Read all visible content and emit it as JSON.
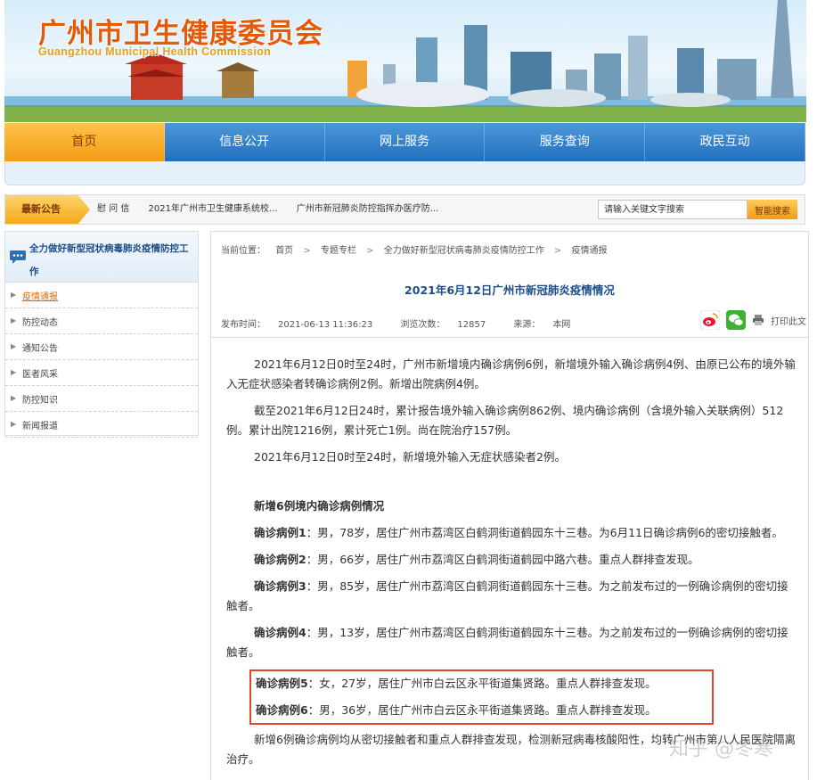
{
  "header": {
    "title_cn": "广州市卫生健康委员会",
    "title_en": "Guangzhou Municipal Health Commission"
  },
  "nav": {
    "items": [
      {
        "label": "首页",
        "active": true
      },
      {
        "label": "信息公开",
        "active": false
      },
      {
        "label": "网上服务",
        "active": false
      },
      {
        "label": "服务查询",
        "active": false
      },
      {
        "label": "政民互动",
        "active": false
      }
    ]
  },
  "notice": {
    "label": "最新公告",
    "items": [
      "慰 问 信",
      "2021年广州市卫生健康系统校...",
      "广州市新冠肺炎防控指挥办医疗防..."
    ]
  },
  "search": {
    "placeholder": "请输入关键文字搜索",
    "button_label": "智能搜索"
  },
  "sidebar": {
    "title": "全力做好新型冠状病毒肺炎疫情防控工作",
    "items": [
      {
        "label": "疫情通报",
        "active": true
      },
      {
        "label": "防控动态",
        "active": false
      },
      {
        "label": "通知公告",
        "active": false
      },
      {
        "label": "医者风采",
        "active": false
      },
      {
        "label": "防控知识",
        "active": false
      },
      {
        "label": "新闻报道",
        "active": false
      }
    ]
  },
  "breadcrumb": {
    "prefix": "当前位置：",
    "items": [
      "首页",
      "专题专栏",
      "全力做好新型冠状病毒肺炎疫情防控工作",
      "疫情通报"
    ],
    "separator": ">"
  },
  "article": {
    "title": "2021年6月12日广州市新冠肺炎疫情情况",
    "publish_label": "发布时间：",
    "publish_time": "2021-06-13 11:36:23",
    "views_label": "浏览次数：",
    "views": "12857",
    "source_label": "来源：",
    "source": "本网",
    "print_label": "打印此文",
    "paragraphs": [
      "2021年6月12日0时至24时，广州市新增境内确诊病例6例，新增境外输入确诊病例4例、由原已公布的境外输入无症状感染者转确诊病例2例。新增出院病例4例。",
      "截至2021年6月12日24时，累计报告境外输入确诊病例862例、境内确诊病例（含境外输入关联病例）512例。累计出院1216例，累计死亡1例。尚在院治疗157例。",
      "2021年6月12日0时至24时，新增境外输入无症状感染者2例。"
    ],
    "section_heading": "新增6例境内确诊病例情况",
    "cases": [
      {
        "label": "确诊病例1",
        "text": "：男，78岁，居住广州市荔湾区白鹤洞街道鹤园东十三巷。为6月11日确诊病例6的密切接触者。"
      },
      {
        "label": "确诊病例2",
        "text": "：男，66岁，居住广州市荔湾区白鹤洞街道鹤园中路六巷。重点人群排查发现。"
      },
      {
        "label": "确诊病例3",
        "text": "：男，85岁，居住广州市荔湾区白鹤洞街道鹤园东十三巷。为之前发布过的一例确诊病例的密切接触者。"
      },
      {
        "label": "确诊病例4",
        "text": "：男，13岁，居住广州市荔湾区白鹤洞街道鹤园东十三巷。为之前发布过的一例确诊病例的密切接触者。"
      },
      {
        "label": "确诊病例5",
        "text": "：女，27岁，居住广州市白云区永平街道集贤路。重点人群排查发现。"
      },
      {
        "label": "确诊病例6",
        "text": "：男，36岁，居住广州市白云区永平街道集贤路。重点人群排查发现。"
      }
    ],
    "closing": "新增6例确诊病例均从密切接触者和重点人群排查发现，检测新冠病毒核酸阳性，均转广州市第八人民医院隔离治疗。"
  },
  "watermark": "知乎 @冬寒",
  "colors": {
    "nav_blue": "#2170be",
    "nav_active": "#f39c12",
    "title_orange": "#e25b0b",
    "link_blue": "#1d4e89",
    "highlight_red": "#e0462a"
  }
}
